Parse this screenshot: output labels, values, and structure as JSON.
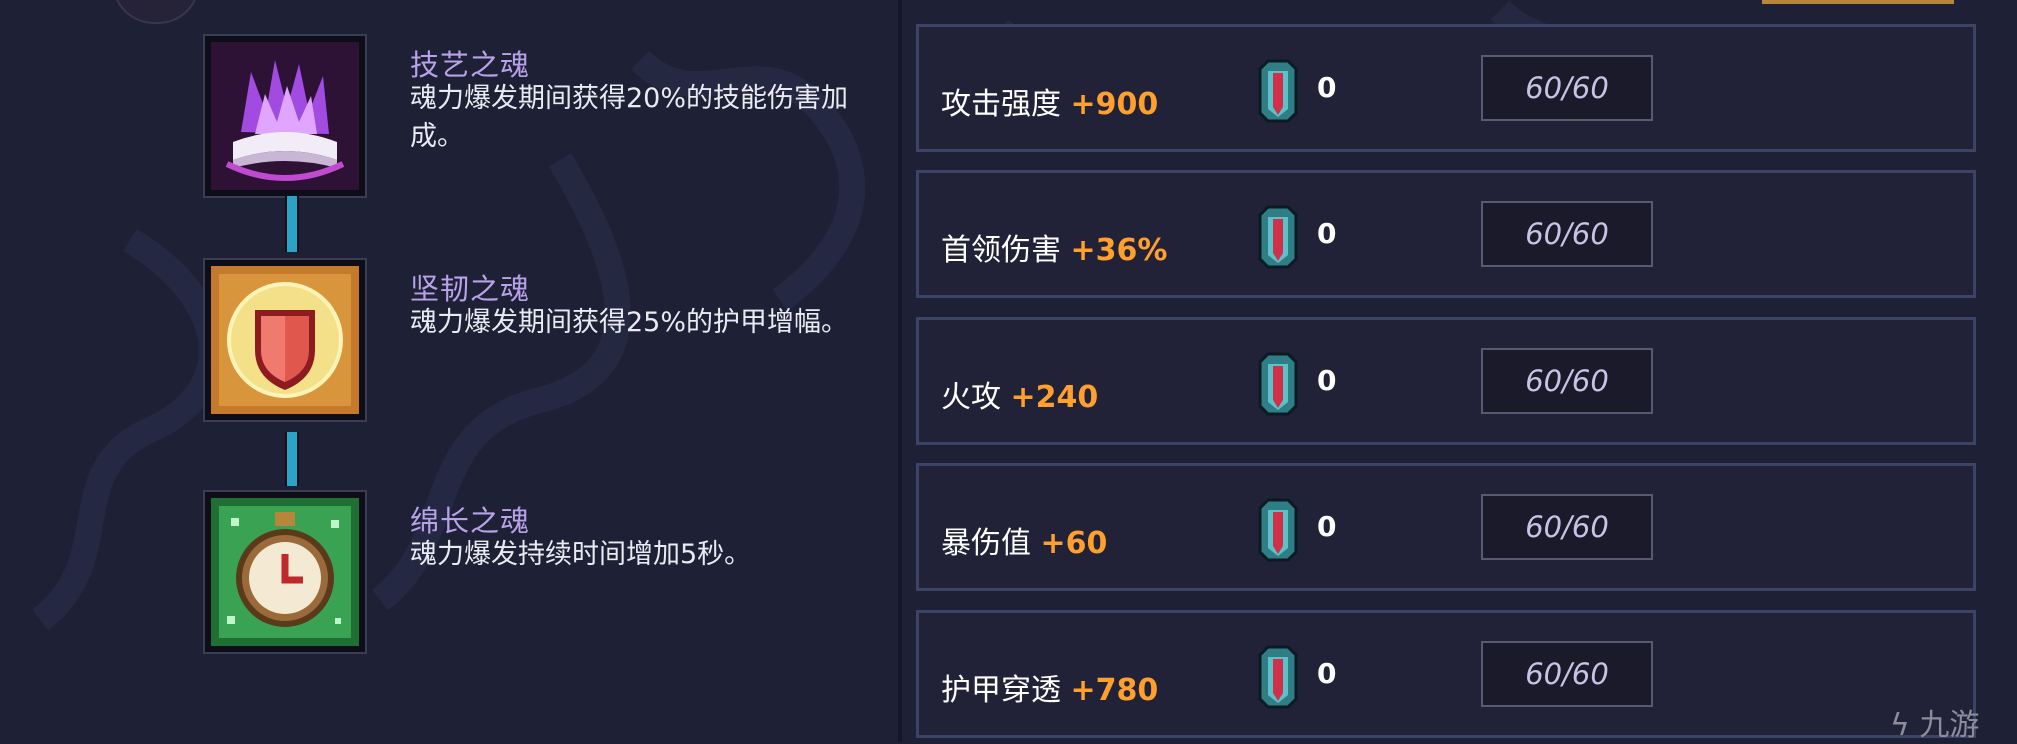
{
  "colors": {
    "background": "#1e2036",
    "skill_name": "#b8a2e8",
    "bonus": "#ff9f2e",
    "connector": "#2aa3c6",
    "row_border": "#3b4466"
  },
  "skills": [
    {
      "name": "技艺之魂",
      "desc": "魂力爆发期间获得20%的技能伤害加成。",
      "icon": "purple-flame-book-icon"
    },
    {
      "name": "坚韧之魂",
      "desc": "魂力爆发期间获得25%的护甲增幅。",
      "icon": "red-shield-icon"
    },
    {
      "name": "绵长之魂",
      "desc": "魂力爆发持续时间增加5秒。",
      "icon": "pocket-watch-icon"
    }
  ],
  "stats": [
    {
      "label": "攻击强度",
      "bonus": "+900",
      "count": "0",
      "progress": "60/60",
      "gem_icon": "soul-gem-icon"
    },
    {
      "label": "首领伤害",
      "bonus": "+36%",
      "count": "0",
      "progress": "60/60",
      "gem_icon": "soul-gem-icon"
    },
    {
      "label": "火攻",
      "bonus": "+240",
      "count": "0",
      "progress": "60/60",
      "gem_icon": "soul-gem-icon"
    },
    {
      "label": "暴伤值",
      "bonus": "+60",
      "count": "0",
      "progress": "60/60",
      "gem_icon": "soul-gem-icon"
    },
    {
      "label": "护甲穿透",
      "bonus": "+780",
      "count": "0",
      "progress": "60/60",
      "gem_icon": "soul-gem-icon"
    }
  ],
  "watermark": {
    "text": "九游",
    "icon": "jiuyou-logo-icon"
  }
}
